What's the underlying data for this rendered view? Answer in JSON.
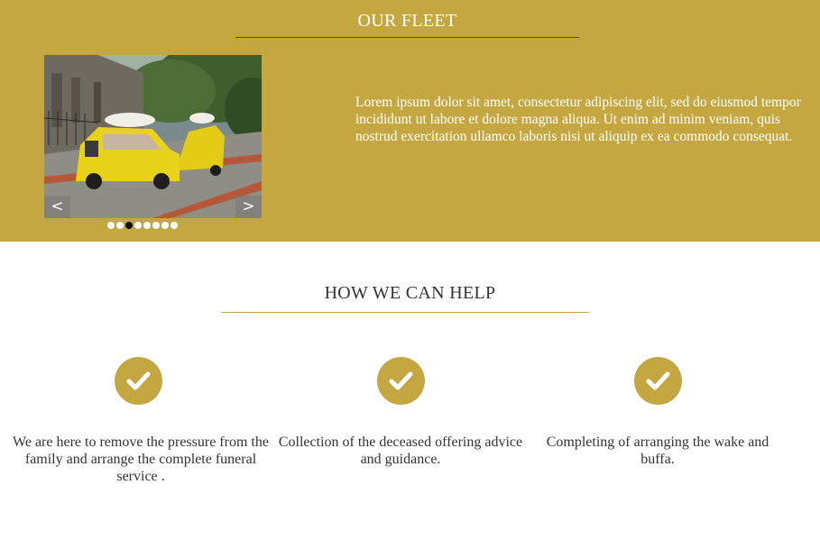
{
  "fleet": {
    "title": "OUR FLEET",
    "description": "Lorem ipsum dolor sit amet, consectetur adipiscing elit, sed do eiusmod tempor incididunt ut labore et dolore magna aliqua. Ut enim ad minim veniam, quis nostrud exercitation ullamco laboris nisi ut aliquip ex ea commodo consequat.",
    "slider": {
      "prev_label": "<",
      "next_label": ">",
      "slide_count": 8,
      "active_slide": 2
    }
  },
  "help": {
    "title": "HOW WE CAN HELP",
    "items": [
      {
        "icon": "check-icon",
        "text": "We are here to remove the pressure from the family and arrange the complete funeral service ."
      },
      {
        "icon": "check-icon",
        "text": "Collection of the deceased offering advice and guidance."
      },
      {
        "icon": "check-icon",
        "text": "Completing of arranging the wake and buffa."
      }
    ]
  },
  "colors": {
    "brand_gold": "#c5a742",
    "text_dark": "#333333",
    "white": "#ffffff"
  }
}
